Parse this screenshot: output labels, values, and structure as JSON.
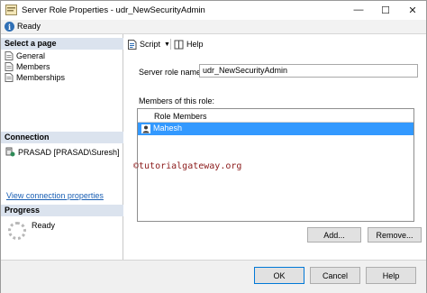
{
  "window": {
    "title": "Server Role Properties - udr_NewSecurityAdmin",
    "controls": {
      "minimize": "—",
      "maximize": "☐",
      "close": "✕"
    }
  },
  "status": {
    "icon": "info-icon",
    "text": "Ready"
  },
  "left_pane": {
    "select_page_header": "Select a page",
    "pages": [
      {
        "label": "General",
        "icon": "page-icon"
      },
      {
        "label": "Members",
        "icon": "page-icon"
      },
      {
        "label": "Memberships",
        "icon": "page-icon"
      }
    ],
    "connection_header": "Connection",
    "connection": "PRASAD [PRASAD\\Suresh]",
    "view_connection_link": "View connection properties",
    "progress_header": "Progress",
    "progress_status": "Ready"
  },
  "toolbar": {
    "script_label": "Script",
    "help_label": "Help"
  },
  "form": {
    "role_name_label": "Server role name:",
    "role_name_value": "udr_NewSecurityAdmin",
    "members_label": "Members of this role:",
    "members_column": "Role Members",
    "members": [
      "Mahesh"
    ]
  },
  "watermark": "©tutorialgateway.org",
  "buttons": {
    "add": "Add...",
    "remove": "Remove...",
    "ok": "OK",
    "cancel": "Cancel",
    "help": "Help"
  },
  "colors": {
    "selection": "#3399ff",
    "pane_header": "#dbe3ee",
    "link": "#1a5fb4",
    "watermark": "#8b1a1a"
  }
}
